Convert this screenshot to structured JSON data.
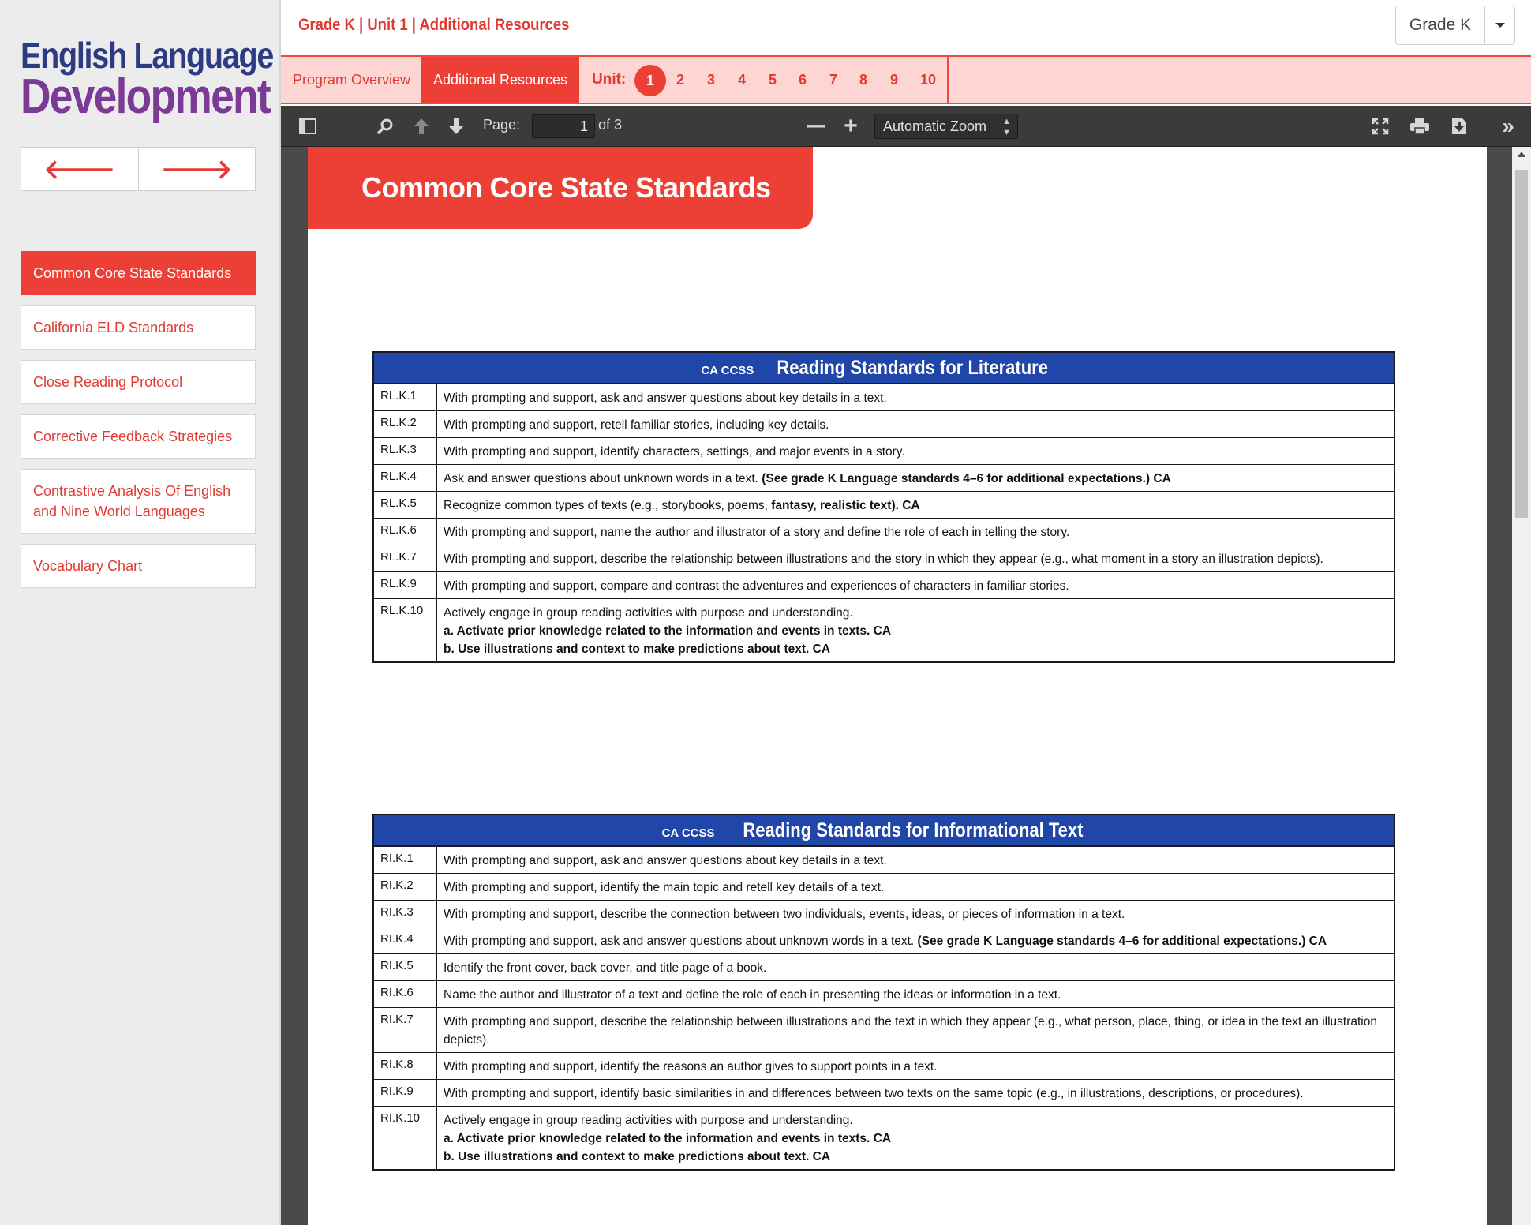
{
  "sidebar": {
    "logo_line1": "English Language",
    "logo_line2": "Development",
    "prev_arrow": "🡐",
    "next_arrow": "🡒",
    "items": [
      {
        "label": "Common Core State Standards"
      },
      {
        "label": "California ELD Standards"
      },
      {
        "label": "Close Reading Protocol"
      },
      {
        "label": "Corrective Feedback Strategies"
      },
      {
        "label": "Contrastive Analysis Of English and Nine World Languages"
      },
      {
        "label": "Vocabulary Chart"
      }
    ]
  },
  "header": {
    "breadcrumb": "Grade K | Unit 1 | Additional Resources",
    "grade_select": "Grade K"
  },
  "tabs": {
    "program_overview": "Program Overview",
    "additional_resources": "Additional Resources",
    "unit_label": "Unit:",
    "units": [
      "1",
      "2",
      "3",
      "4",
      "5",
      "6",
      "7",
      "8",
      "9",
      "10"
    ],
    "active_unit": "1"
  },
  "viewer": {
    "page_label": "Page:",
    "page_value": "1",
    "page_total": "of 3",
    "zoom_minus": "—",
    "zoom_plus": "+",
    "zoom": "Automatic Zoom"
  },
  "document": {
    "banner": "Common Core State Standards",
    "tables": [
      {
        "prefix": "CA CCSS",
        "title": "Reading Standards for Literature",
        "rows": [
          {
            "code": "RL.K.1",
            "text": "With prompting and support, ask and answer questions about key details in a text.",
            "bold": ""
          },
          {
            "code": "RL.K.2",
            "text": "With prompting and support, retell familiar stories, including key details.",
            "bold": ""
          },
          {
            "code": "RL.K.3",
            "text": "With prompting and support, identify characters, settings, and major events in a story.",
            "bold": ""
          },
          {
            "code": "RL.K.4",
            "text": "Ask and answer questions about unknown words in a text. ",
            "bold": "(See grade K Language standards 4–6 for additional expectations.) CA"
          },
          {
            "code": "RL.K.5",
            "text": "Recognize common types of texts (e.g., storybooks, poems, ",
            "bold": "fantasy, realistic text). CA"
          },
          {
            "code": "RL.K.6",
            "text": "With prompting and support, name the author and illustrator of a story and define the role of each in telling the story.",
            "bold": ""
          },
          {
            "code": "RL.K.7",
            "text": "With prompting and support, describe the relationship between illustrations and the story in which they appear (e.g., what moment in a story an illustration depicts).",
            "bold": ""
          },
          {
            "code": "RL.K.9",
            "text": "With prompting and support, compare and contrast the adventures and experiences of characters in familiar stories.",
            "bold": ""
          },
          {
            "code": "RL.K.10",
            "text": "Actively engage in group reading activities with purpose and understanding.",
            "sub_a": "a. Activate prior knowledge related to the information and events in texts. CA",
            "sub_b": "b. Use illustrations and context to make predictions about text. CA"
          }
        ]
      },
      {
        "prefix": "CA CCSS",
        "title": "Reading Standards for Informational Text",
        "rows": [
          {
            "code": "RI.K.1",
            "text": "With prompting and support, ask and answer questions about key details in a text.",
            "bold": ""
          },
          {
            "code": "RI.K.2",
            "text": "With prompting and support, identify the main topic and retell key details of a text.",
            "bold": ""
          },
          {
            "code": "RI.K.3",
            "text": "With prompting and support, describe the connection between two individuals, events, ideas, or pieces of information in a text.",
            "bold": ""
          },
          {
            "code": "RI.K.4",
            "text": "With prompting and support, ask and answer questions about unknown words in a text. ",
            "bold": "(See grade K Language standards 4–6 for additional expectations.) CA"
          },
          {
            "code": "RI.K.5",
            "text": "Identify the front cover, back cover, and title page of a book.",
            "bold": ""
          },
          {
            "code": "RI.K.6",
            "text": "Name the author and illustrator of a text and define the role of each in presenting the ideas or information in a text.",
            "bold": ""
          },
          {
            "code": "RI.K.7",
            "text": "With prompting and support, describe the relationship between illustrations and the text in which they appear (e.g., what person, place, thing, or idea in the text an illustration depicts).",
            "bold": ""
          },
          {
            "code": "RI.K.8",
            "text": "With prompting and support, identify the reasons an author gives to support points in a text.",
            "bold": ""
          },
          {
            "code": "RI.K.9",
            "text": "With prompting and support, identify basic similarities in and differences between two texts on the same topic (e.g., in illustrations, descriptions, or procedures).",
            "bold": ""
          },
          {
            "code": "RI.K.10",
            "text": "Actively engage in group reading activities with purpose and understanding.",
            "sub_a": "a. Activate prior knowledge related to the information and events in texts. CA",
            "sub_b": "b. Use illustrations and context to make predictions about text. CA"
          }
        ]
      }
    ]
  },
  "colors": {
    "accent_red": "#ec3f35",
    "table_header_blue": "#1f46a8",
    "logo_blue": "#2d3a84",
    "logo_purple": "#7b3a96"
  }
}
